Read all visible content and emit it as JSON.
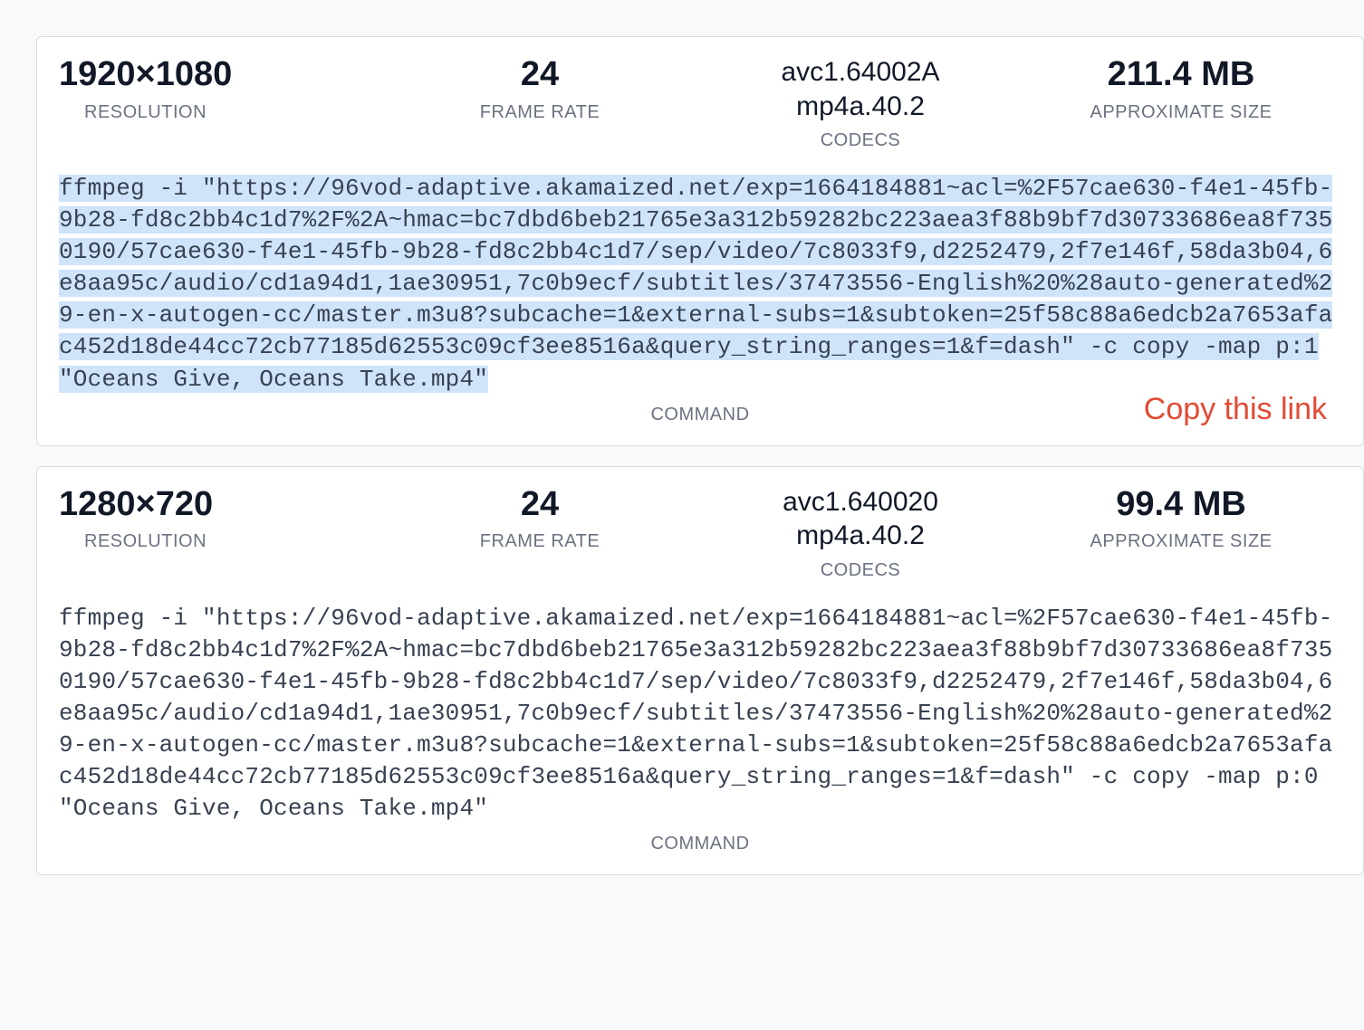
{
  "labels": {
    "resolution": "RESOLUTION",
    "frame_rate": "FRAME RATE",
    "codecs": "CODECS",
    "approx_size": "APPROXIMATE SIZE",
    "command": "COMMAND"
  },
  "annotation": "Copy this link",
  "cards": [
    {
      "resolution": "1920×1080",
      "frame_rate": "24",
      "codec_video": "avc1.64002A",
      "codec_audio": "mp4a.40.2",
      "approx_size": "211.4 MB",
      "selected": true,
      "command": "ffmpeg -i \"https://96vod-adaptive.akamaized.net/exp=1664184881~acl=%2F57cae630-f4e1-45fb-9b28-fd8c2bb4c1d7%2F%2A~hmac=bc7dbd6beb21765e3a312b59282bc223aea3f88b9bf7d30733686ea8f7350190/57cae630-f4e1-45fb-9b28-fd8c2bb4c1d7/sep/video/7c8033f9,d2252479,2f7e146f,58da3b04,6e8aa95c/audio/cd1a94d1,1ae30951,7c0b9ecf/subtitles/37473556-English%20%28auto-generated%29-en-x-autogen-cc/master.m3u8?subcache=1&external-subs=1&subtoken=25f58c88a6edcb2a7653afac452d18de44cc72cb77185d62553c09cf3ee8516a&query_string_ranges=1&f=dash\" -c copy -map p:1 \"Oceans Give, Oceans Take.mp4\""
    },
    {
      "resolution": "1280×720",
      "frame_rate": "24",
      "codec_video": "avc1.640020",
      "codec_audio": "mp4a.40.2",
      "approx_size": "99.4 MB",
      "selected": false,
      "command": "ffmpeg -i \"https://96vod-adaptive.akamaized.net/exp=1664184881~acl=%2F57cae630-f4e1-45fb-9b28-fd8c2bb4c1d7%2F%2A~hmac=bc7dbd6beb21765e3a312b59282bc223aea3f88b9bf7d30733686ea8f7350190/57cae630-f4e1-45fb-9b28-fd8c2bb4c1d7/sep/video/7c8033f9,d2252479,2f7e146f,58da3b04,6e8aa95c/audio/cd1a94d1,1ae30951,7c0b9ecf/subtitles/37473556-English%20%28auto-generated%29-en-x-autogen-cc/master.m3u8?subcache=1&external-subs=1&subtoken=25f58c88a6edcb2a7653afac452d18de44cc72cb77185d62553c09cf3ee8516a&query_string_ranges=1&f=dash\" -c copy -map p:0 \"Oceans Give, Oceans Take.mp4\""
    }
  ]
}
